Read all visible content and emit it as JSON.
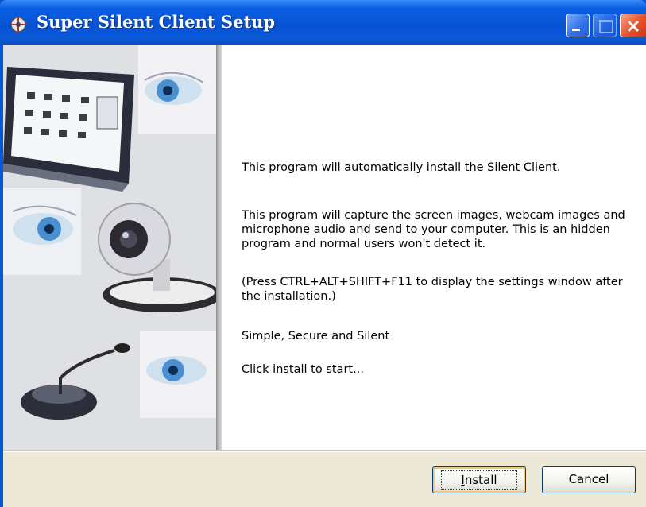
{
  "window": {
    "title": "Super Silent Client Setup"
  },
  "titlebar_buttons": {
    "minimize": "minimize-icon",
    "maximize": "maximize-icon",
    "close": "close-icon"
  },
  "content": {
    "paragraphs": [
      "This program will automatically install the Silent Client.",
      "This program will capture the screen images, webcam images and microphone audio and send to your computer. This is an hidden program and normal users won't detect it.",
      "(Press CTRL+ALT+SHIFT+F11 to display the settings window after the installation.)",
      "Simple, Secure and Silent",
      "Click install to start..."
    ]
  },
  "buttons": {
    "install_first": "I",
    "install_rest": "nstall",
    "cancel": "Cancel"
  },
  "colors": {
    "titlebar": "#0a56d8",
    "client_bg": "#ece9d8",
    "button_border": "#003c74"
  }
}
